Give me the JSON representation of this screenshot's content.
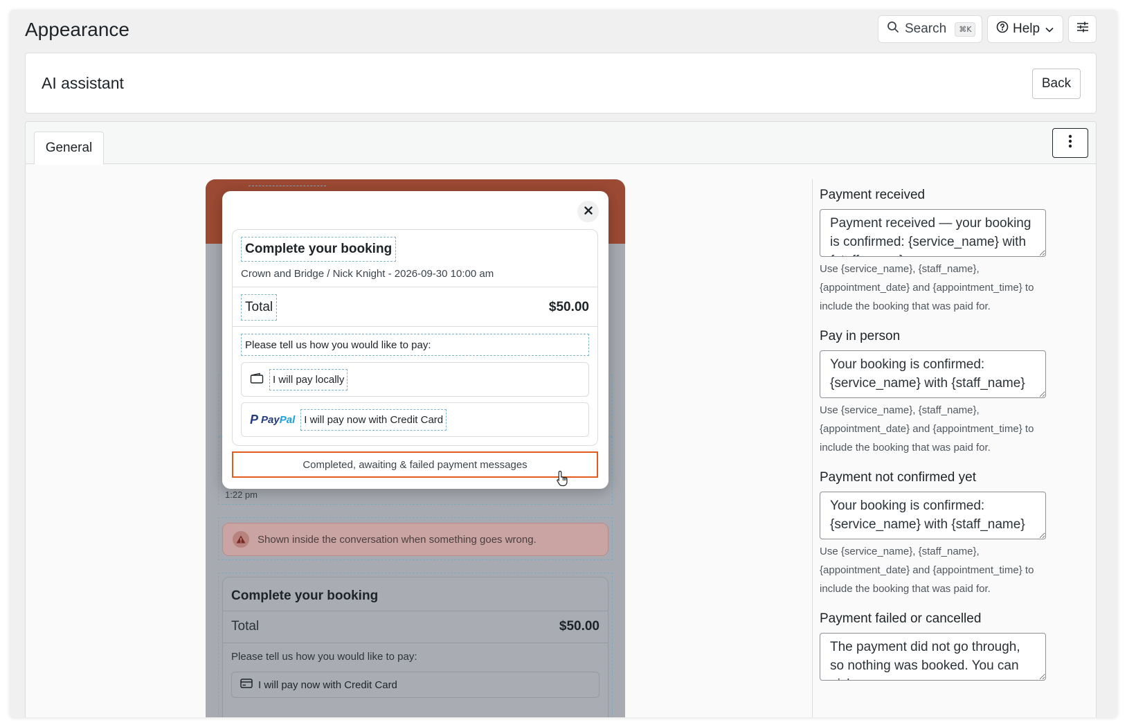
{
  "topbar": {
    "page_title": "Appearance",
    "search_label": "Search",
    "search_shortcut": "⌘K",
    "help_label": "Help"
  },
  "header": {
    "title": "AI assistant",
    "back_label": "Back"
  },
  "tabs": {
    "general_label": "General"
  },
  "preview": {
    "bubble_time": "1:22 pm",
    "error_text": "Shown inside the conversation when something goes wrong.",
    "bg_card": {
      "title": "Complete your booking",
      "total_label": "Total",
      "total_amount": "$50.00",
      "ask_text": "Please tell us how you would like to pay:",
      "option_card_label": "I will pay now with Credit Card"
    }
  },
  "modal": {
    "booking_title": "Complete your booking",
    "booking_subtitle": "Crown and Bridge / Nick Knight - 2026-09-30 10:00 am",
    "total_label": "Total",
    "total_amount": "$50.00",
    "ask_text": "Please tell us how you would like to pay:",
    "option_local_label": "I will pay locally",
    "paypal_logo_pay": "Pay",
    "paypal_logo_pal": "Pal",
    "option_card_label": "I will pay now with Credit Card",
    "messages_button": "Completed, awaiting & failed payment messages"
  },
  "settings": {
    "fields": [
      {
        "label": "Payment received",
        "value": "Payment received — your booking is confirmed: {service_name} with {staff_name}",
        "help": "Use {service_name}, {staff_name}, {appointment_date} and {appointment_time} to include the booking that was paid for."
      },
      {
        "label": "Pay in person",
        "value": "Your booking is confirmed: {service_name} with {staff_name}",
        "help": "Use {service_name}, {staff_name}, {appointment_date} and {appointment_time} to include the booking that was paid for."
      },
      {
        "label": "Payment not confirmed yet",
        "value": "Your booking is confirmed: {service_name} with {staff_name}",
        "help": "Use {service_name}, {staff_name}, {appointment_date} and {appointment_time} to include the booking that was paid for."
      },
      {
        "label": "Payment failed or cancelled",
        "value": "The payment did not go through, so nothing was booked. You can pick a",
        "help": ""
      }
    ]
  },
  "colors": {
    "accent_orange": "#e25a1c",
    "preview_header": "#9c4a33",
    "paypal_dark": "#253b80",
    "paypal_light": "#1a9fe0"
  },
  "icons": [
    "search-icon",
    "help-circle-icon",
    "chevron-down-icon",
    "sliders-icon",
    "kebab-menu-icon",
    "close-icon",
    "wallet-icon",
    "paypal-logo",
    "warning-icon",
    "credit-card-icon",
    "pointer-cursor-icon"
  ]
}
